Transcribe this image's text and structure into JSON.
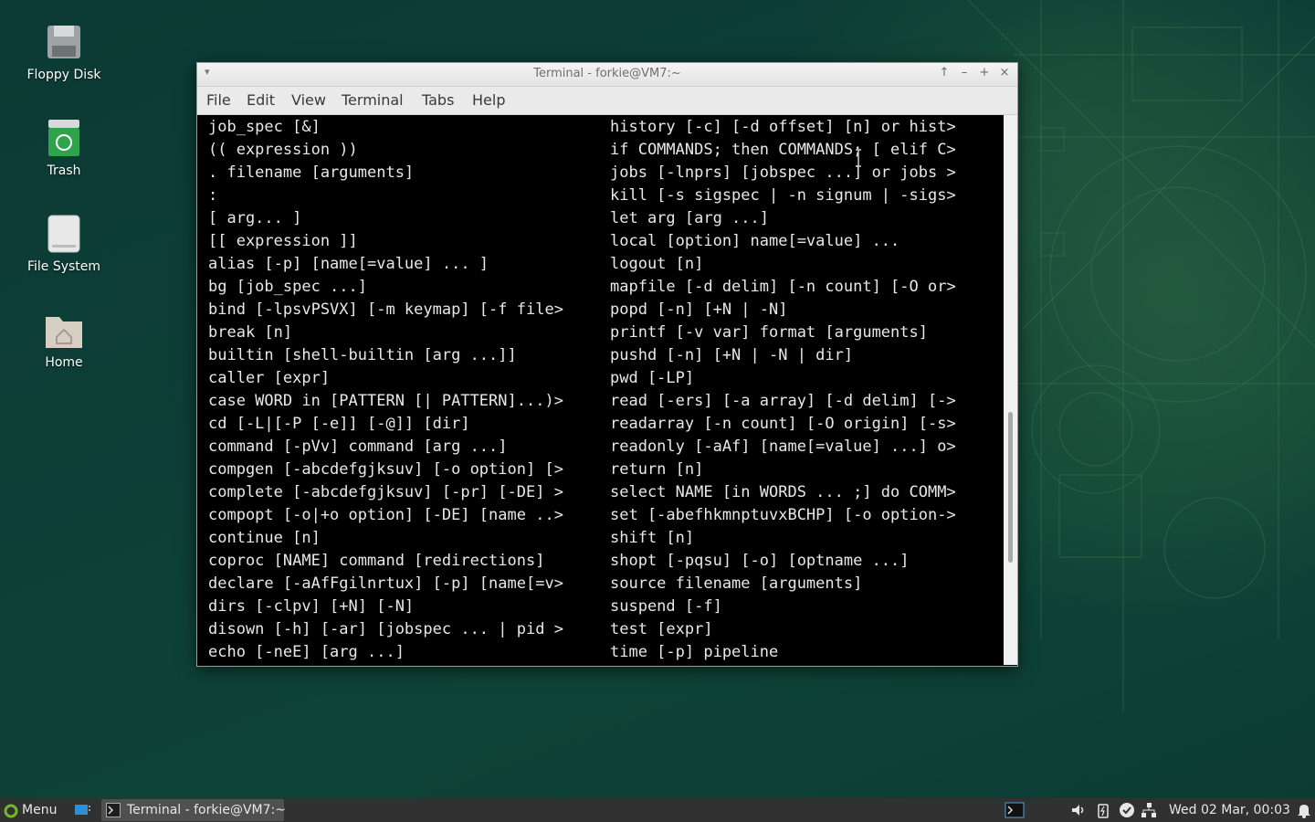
{
  "desktop": {
    "icons": [
      {
        "label": "Floppy Disk",
        "icon": "floppy-disk-icon"
      },
      {
        "label": "Trash",
        "icon": "trash-icon"
      },
      {
        "label": "File System",
        "icon": "drive-icon"
      },
      {
        "label": "Home",
        "icon": "home-folder-icon"
      }
    ]
  },
  "window": {
    "title": "Terminal - forkie@VM7:~",
    "controls": {
      "shade": "↑",
      "minimize": "–",
      "maximize": "+",
      "close": "×"
    },
    "menu": [
      "File",
      "Edit",
      "View",
      "Terminal",
      "Tabs",
      "Help"
    ]
  },
  "terminal": {
    "left_column": [
      "job_spec [&]",
      "(( expression ))",
      ". filename [arguments]",
      ":",
      "[ arg... ]",
      "[[ expression ]]",
      "alias [-p] [name[=value] ... ]",
      "bg [job_spec ...]",
      "bind [-lpsvPSVX] [-m keymap] [-f file>",
      "break [n]",
      "builtin [shell-builtin [arg ...]]",
      "caller [expr]",
      "case WORD in [PATTERN [| PATTERN]...)>",
      "cd [-L|[-P [-e]] [-@]] [dir]",
      "command [-pVv] command [arg ...]",
      "compgen [-abcdefgjksuv] [-o option] [>",
      "complete [-abcdefgjksuv] [-pr] [-DE] >",
      "compopt [-o|+o option] [-DE] [name ..>",
      "continue [n]",
      "coproc [NAME] command [redirections]",
      "declare [-aAfFgilnrtux] [-p] [name[=v>",
      "dirs [-clpv] [+N] [-N]",
      "disown [-h] [-ar] [jobspec ... | pid >",
      "echo [-neE] [arg ...]"
    ],
    "right_column": [
      "history [-c] [-d offset] [n] or hist>",
      "if COMMANDS; then COMMANDS; [ elif C>",
      "jobs [-lnprs] [jobspec ...] or jobs >",
      "kill [-s sigspec | -n signum | -sigs>",
      "let arg [arg ...]",
      "local [option] name[=value] ...",
      "logout [n]",
      "mapfile [-d delim] [-n count] [-O or>",
      "popd [-n] [+N | -N]",
      "printf [-v var] format [arguments]",
      "pushd [-n] [+N | -N | dir]",
      "pwd [-LP]",
      "read [-ers] [-a array] [-d delim] [->",
      "readarray [-n count] [-O origin] [-s>",
      "readonly [-aAf] [name[=value] ...] o>",
      "return [n]",
      "select NAME [in WORDS ... ;] do COMM>",
      "set [-abefhkmnptuvxBCHP] [-o option->",
      "shift [n]",
      "shopt [-pqsu] [-o] [optname ...]",
      "source filename [arguments]",
      "suspend [-f]",
      "test [expr]",
      "time [-p] pipeline"
    ]
  },
  "taskbar": {
    "menu_label": "Menu",
    "task_label": "Terminal - forkie@VM7:~",
    "clock": "Wed 02 Mar, 00:03",
    "tray_icons": [
      "terminal-tray-icon",
      "volume-icon",
      "battery-icon",
      "updates-check-icon",
      "network-icon",
      "notifications-bell-icon"
    ]
  },
  "colors": {
    "terminal_bg": "#000000",
    "terminal_fg": "#e8e8e8",
    "desktop_bg": "#0d3d36",
    "taskbar_bg": "#313131"
  }
}
